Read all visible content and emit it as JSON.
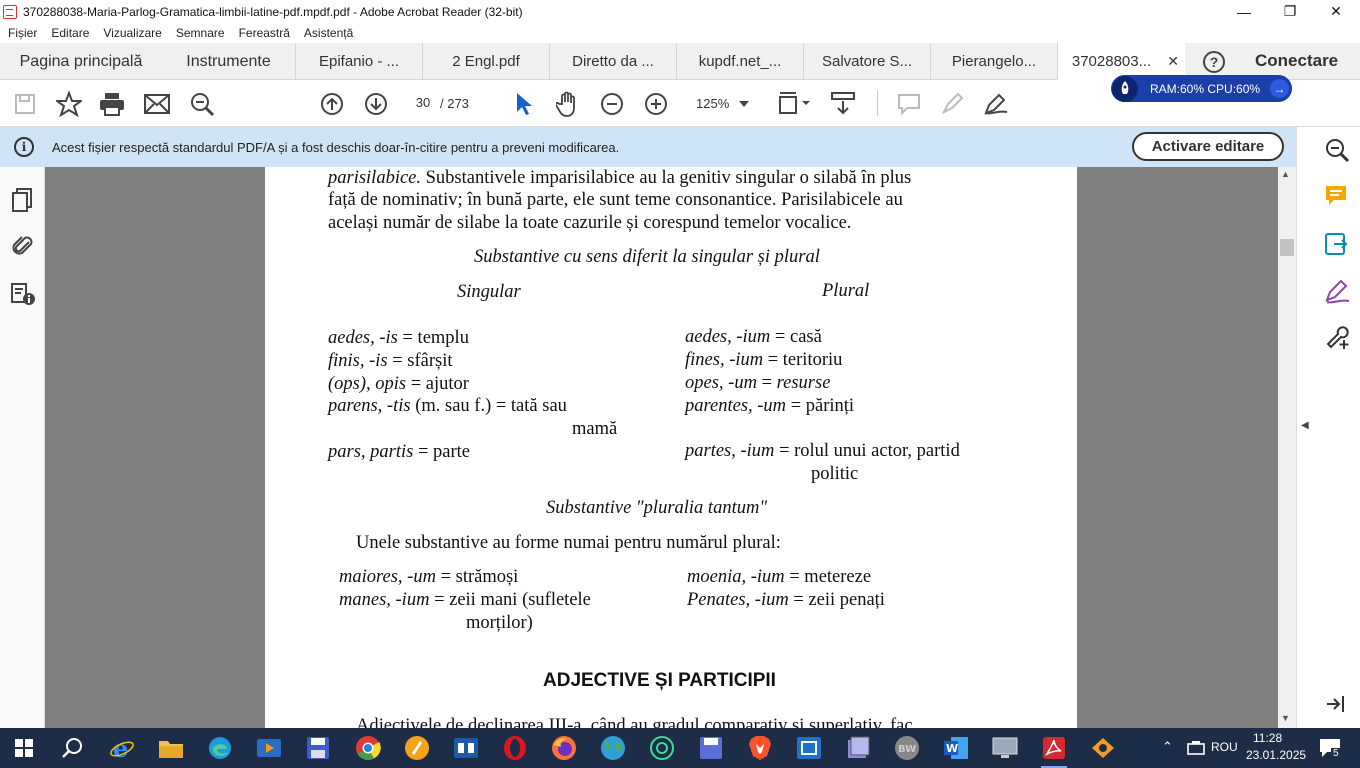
{
  "window": {
    "title": "370288038-Maria-Parlog-Gramatica-limbii-latine-pdf.mpdf.pdf - Adobe Acrobat Reader (32-bit)",
    "minimize": "—",
    "maximize": "❐",
    "close": "✕"
  },
  "menu": [
    "Fișier",
    "Editare",
    "Vizualizare",
    "Semnare",
    "Fereastră",
    "Asistență"
  ],
  "tabs": {
    "home": "Pagina principală",
    "tools": "Instrumente",
    "docs": [
      "Epifanio - ...",
      "2 Engl.pdf",
      "Diretto da ...",
      "kupdf.net_...",
      "Salvatore S...",
      "Pierangelo..."
    ],
    "active": "37028803...",
    "active_close": "✕",
    "help": "?",
    "connect": "Conectare"
  },
  "toolbar": {
    "page_current": "30",
    "page_total": "/  273",
    "zoom": "125%"
  },
  "perf": {
    "text": "RAM:60%  CPU:60%",
    "arrow": "→"
  },
  "infobar": {
    "icon": "i",
    "message": "Acest fișier respectă standardul PDF/A și a fost deschis doar-în-citire pentru a preveni modificarea.",
    "button": "Activare editare"
  },
  "doc": {
    "para1": "parisilabice. Substantivele imparisilabice au la genitiv singular o silabă în plus",
    "para1_it": "parisilabice.",
    "para1_rest": " Substantivele imparisilabice au la genitiv singular o silabă în plus",
    "para2": "față de nominativ; în bună parte, ele sunt teme consonantice. Parisilabicele au",
    "para3": "același număr de silabe la toate cazurile și corespund temelor vocalice.",
    "heading1": "Substantive cu sens diferit la singular și plural",
    "col_singular": "Singular",
    "col_plural": "Plural",
    "rows": [
      {
        "s_it": "aedes, -is",
        "s_rest": " = templu",
        "p_it": "aedes, -ium",
        "p_rest": " = casă"
      },
      {
        "s_it": "finis, -is",
        "s_rest": " = sfârșit",
        "p_it": "fines, -ium",
        "p_rest": " = teritoriu"
      },
      {
        "s_it": "(ops), opis",
        "s_rest": " = ajutor",
        "p_it": "opes, -um",
        "p_rest": " = ",
        "p_it2": "resurse"
      },
      {
        "s_it": "parens, -tis",
        "s_rest": " (m. sau f.) = tată sau",
        "p_it": "parentes, -um",
        "p_rest": " = părinți"
      },
      {
        "s_cont": "mamă"
      },
      {
        "s_it": "pars, partis",
        "s_rest": " = parte",
        "p_it": "partes, -ium",
        "p_rest": " = rolul unui actor, partid"
      },
      {
        "p_cont": "politic"
      }
    ],
    "heading2": "Substantive \"pluralia tantum\"",
    "intro2": "Unele substantive au forme numai pentru numărul plural:",
    "pt_rows": [
      {
        "l_it": "maiores, -um",
        "l_rest": " = strămoși",
        "r_it": "moenia, -ium",
        "r_rest": " = metereze"
      },
      {
        "l_it": "manes, -ium",
        "l_rest": " = zeii mani (sufletele",
        "r_it": "Penates, -ium",
        "r_rest": " = zeii penați"
      },
      {
        "l_cont": "morților)"
      }
    ],
    "heading3": "ADJECTIVE ȘI PARTICIPII",
    "cutoff": "Adjectivele de declinarea III-a, când au gradul comparativ și superlativ, fac"
  },
  "taskbar": {
    "lang": "ROU",
    "time": "11:28",
    "date": "23.01.2025",
    "notif_count": "5"
  }
}
